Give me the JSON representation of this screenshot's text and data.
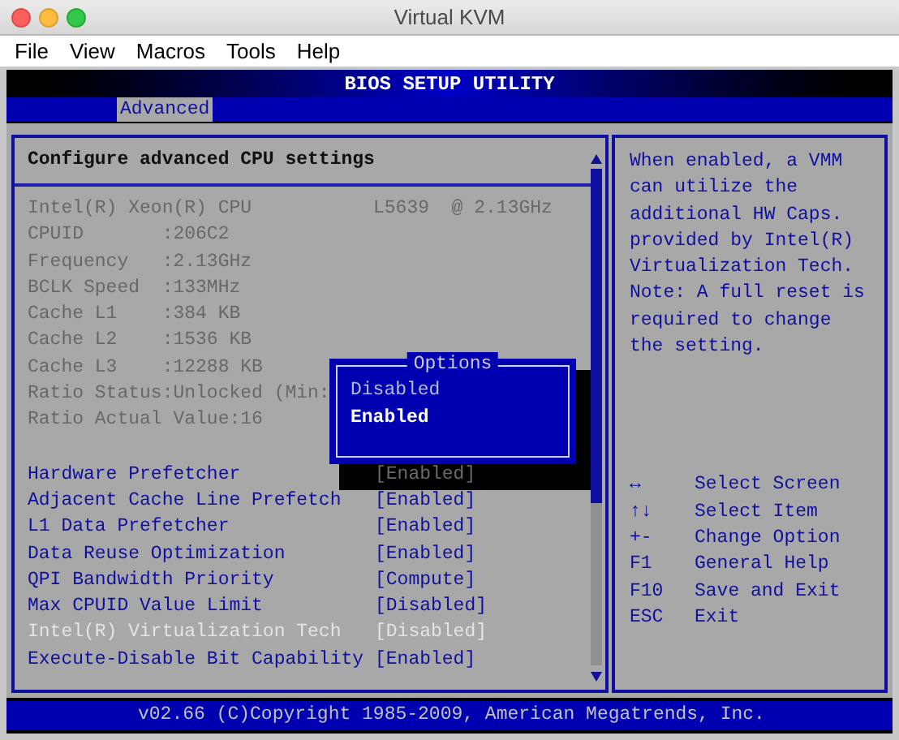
{
  "window": {
    "title": "Virtual KVM"
  },
  "menu": [
    "File",
    "View",
    "Macros",
    "Tools",
    "Help"
  ],
  "bios": {
    "title": "BIOS SETUP UTILITY",
    "tabs": [
      {
        "label": "Advanced",
        "selected": true
      }
    ],
    "heading": "Configure advanced CPU settings",
    "info": [
      {
        "text": "Intel(R) Xeon(R) CPU",
        "value": "L5639  @ 2.13GHz"
      },
      {
        "text": "CPUID       :206C2"
      },
      {
        "text": "Frequency   :2.13GHz"
      },
      {
        "text": "BCLK Speed  :133MHz"
      },
      {
        "text": "Cache L1    :384 KB"
      },
      {
        "text": "Cache L2    :1536 KB"
      },
      {
        "text": "Cache L3    :12288 KB"
      },
      {
        "text": "Ratio Status:Unlocked (Min:"
      },
      {
        "text": "Ratio Actual Value:16"
      }
    ],
    "settings": [
      {
        "label": "Hardware Prefetcher",
        "value": "[Enabled]",
        "selected": false,
        "shadowed": true
      },
      {
        "label": "Adjacent Cache Line Prefetch",
        "value": "[Enabled]",
        "selected": false,
        "shadowed": false
      },
      {
        "label": "L1 Data Prefetcher",
        "value": "[Enabled]",
        "selected": false,
        "shadowed": false
      },
      {
        "label": "Data Reuse Optimization",
        "value": "[Enabled]",
        "selected": false,
        "shadowed": false
      },
      {
        "label": "QPI Bandwidth Priority",
        "value": "[Compute]",
        "selected": false,
        "shadowed": false
      },
      {
        "label": "Max CPUID Value Limit",
        "value": "[Disabled]",
        "selected": false,
        "shadowed": false
      },
      {
        "label": "Intel(R) Virtualization Tech",
        "value": "[Disabled]",
        "selected": true,
        "shadowed": false
      },
      {
        "label": "Execute-Disable Bit Capability",
        "value": "[Enabled]",
        "selected": false,
        "shadowed": false
      }
    ],
    "popup": {
      "title": "Options",
      "options": [
        {
          "label": "Disabled",
          "selected": false
        },
        {
          "label": "Enabled",
          "selected": true
        }
      ]
    },
    "help": "When enabled, a VMM\ncan utilize the\nadditional HW Caps.\nprovided by Intel(R)\nVirtualization Tech.\nNote: A full reset is\nrequired to change\nthe setting.",
    "keys": [
      {
        "key": "↔",
        "action": "Select Screen"
      },
      {
        "key": "↑↓",
        "action": "Select Item"
      },
      {
        "key": "+-",
        "action": "Change Option"
      },
      {
        "key": "F1",
        "action": "General Help"
      },
      {
        "key": "F10",
        "action": "Save and Exit"
      },
      {
        "key": "ESC",
        "action": "Exit"
      }
    ],
    "footer": "v02.66 (C)Copyright 1985-2009, American Megatrends, Inc."
  }
}
